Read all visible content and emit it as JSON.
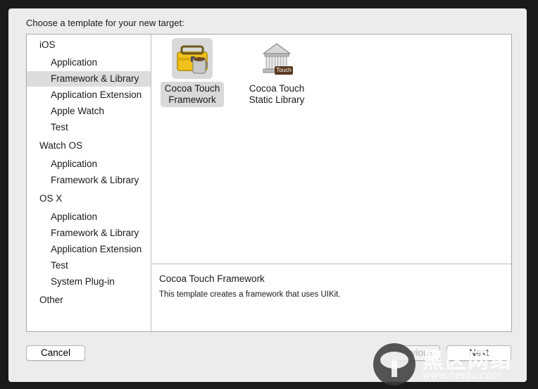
{
  "header": {
    "title": "Choose a template for your new target:"
  },
  "sidebar": {
    "sections": [
      {
        "label": "iOS",
        "items": [
          "Application",
          "Framework & Library",
          "Application Extension",
          "Apple Watch",
          "Test"
        ]
      },
      {
        "label": "Watch OS",
        "items": [
          "Application",
          "Framework & Library"
        ]
      },
      {
        "label": "OS X",
        "items": [
          "Application",
          "Framework & Library",
          "Application Extension",
          "Test",
          "System Plug-in"
        ]
      },
      {
        "label": "Other",
        "items": []
      }
    ],
    "selected": "iOS / Framework & Library"
  },
  "templates": [
    {
      "label_line1": "Cocoa Touch",
      "label_line2": "Framework",
      "icon": "toolbox-framework-icon",
      "selected": true
    },
    {
      "label_line1": "Cocoa Touch",
      "label_line2": "Static Library",
      "icon": "library-building-icon",
      "badge": "Touch",
      "selected": false
    }
  ],
  "description": {
    "title": "Cocoa Touch Framework",
    "body": "This template creates a framework that uses UIKit."
  },
  "buttons": {
    "cancel": "Cancel",
    "previous": "Previous",
    "next": "Next"
  },
  "watermark": {
    "main": "黑区网络",
    "sub": "www.heiqu.com"
  }
}
